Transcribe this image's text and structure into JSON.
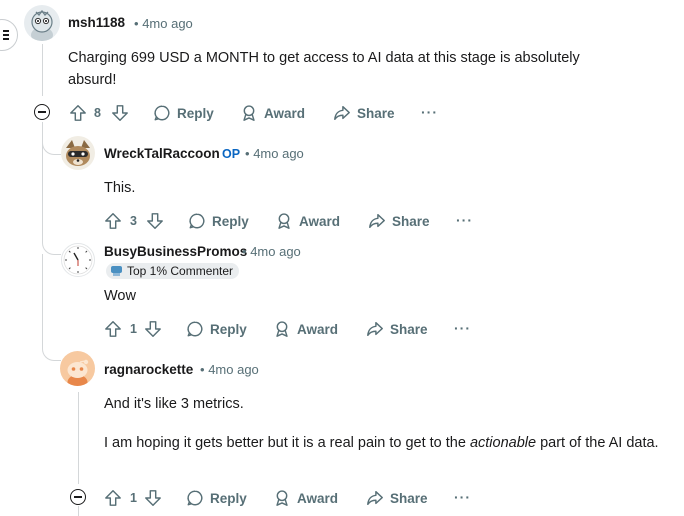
{
  "comments": [
    {
      "username": "msh1188",
      "time": "4mo ago",
      "body": "Charging 699 USD a MONTH to get access to AI data at this stage is absolutely absurd!",
      "votes": "8"
    },
    {
      "username": "WreckTalRaccoon",
      "op_label": "OP",
      "time": "4mo ago",
      "body": "This.",
      "votes": "3"
    },
    {
      "username": "BusyBusinessPromos",
      "time": "4mo ago",
      "badge": "Top 1% Commenter",
      "body": "Wow",
      "votes": "1"
    },
    {
      "username": "ragnarockette",
      "time": "4mo ago",
      "body_p1": "And it's like 3 metrics.",
      "body_p2_before": "I am hoping it gets better but it is a real pain to get to the ",
      "body_p2_em": "actionable",
      "body_p2_after": " part of the AI data.",
      "votes": "1"
    }
  ],
  "actions": {
    "reply": "Reply",
    "award": "Award",
    "share": "Share",
    "more": "···"
  },
  "separator": "•",
  "colors": {
    "op": "#0a66c2",
    "muted": "#576f76",
    "thread": "#d4d7d9"
  },
  "icons": [
    "menu-icon",
    "upvote-icon",
    "downvote-icon",
    "reply-icon",
    "award-icon",
    "share-icon",
    "collapse-icon"
  ]
}
